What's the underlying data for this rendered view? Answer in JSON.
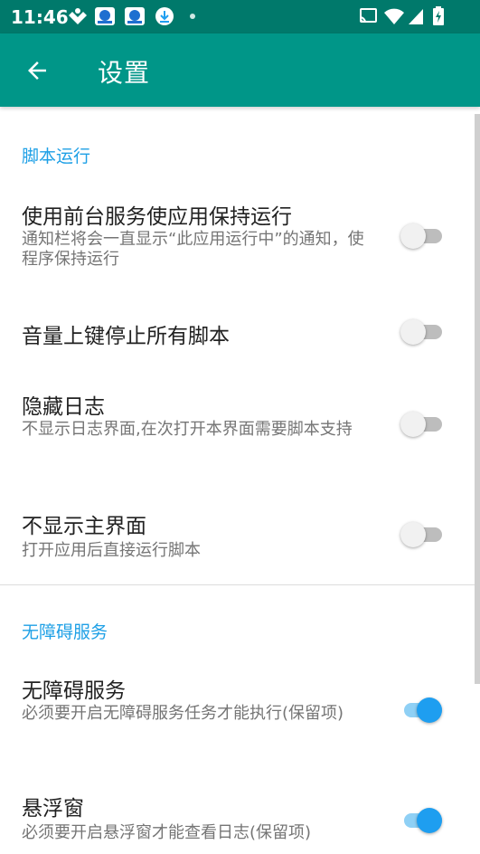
{
  "statusbar": {
    "time": "11:46",
    "icons": [
      "app-notification-icon",
      "app-badge-icon",
      "app-badge-icon",
      "download-icon",
      "dot-icon"
    ],
    "right_icons": [
      "cast-icon",
      "wifi-icon",
      "signal-icon",
      "battery-icon"
    ]
  },
  "appbar": {
    "title": "设置",
    "back_icon": "arrow-back-icon",
    "color": "#009688"
  },
  "sections": [
    {
      "title": "脚本运行",
      "items": [
        {
          "title": "使用前台服务使应用保持运行",
          "summary": "通知栏将会一直显示“此应用运行中”的通知，使程序保持运行",
          "checked": false
        },
        {
          "title": "音量上键停止所有脚本",
          "summary": "",
          "checked": false
        },
        {
          "title": "隐藏日志",
          "summary": "不显示日志界面,在次打开本界面需要脚本支持",
          "checked": false
        },
        {
          "title": "不显示主界面",
          "summary": "打开应用后直接运行脚本",
          "checked": false
        }
      ]
    },
    {
      "title": "无障碍服务",
      "items": [
        {
          "title": "无障碍服务",
          "summary": "必须要开启无障碍服务任务才能执行(保留项)",
          "checked": true
        },
        {
          "title": "悬浮窗",
          "summary": "必须要开启悬浮窗才能查看日志(保留项)",
          "checked": true
        }
      ]
    }
  ],
  "colors": {
    "accent": "#1ea0e6",
    "statusbar": "#00796b",
    "toolbar": "#009688"
  }
}
